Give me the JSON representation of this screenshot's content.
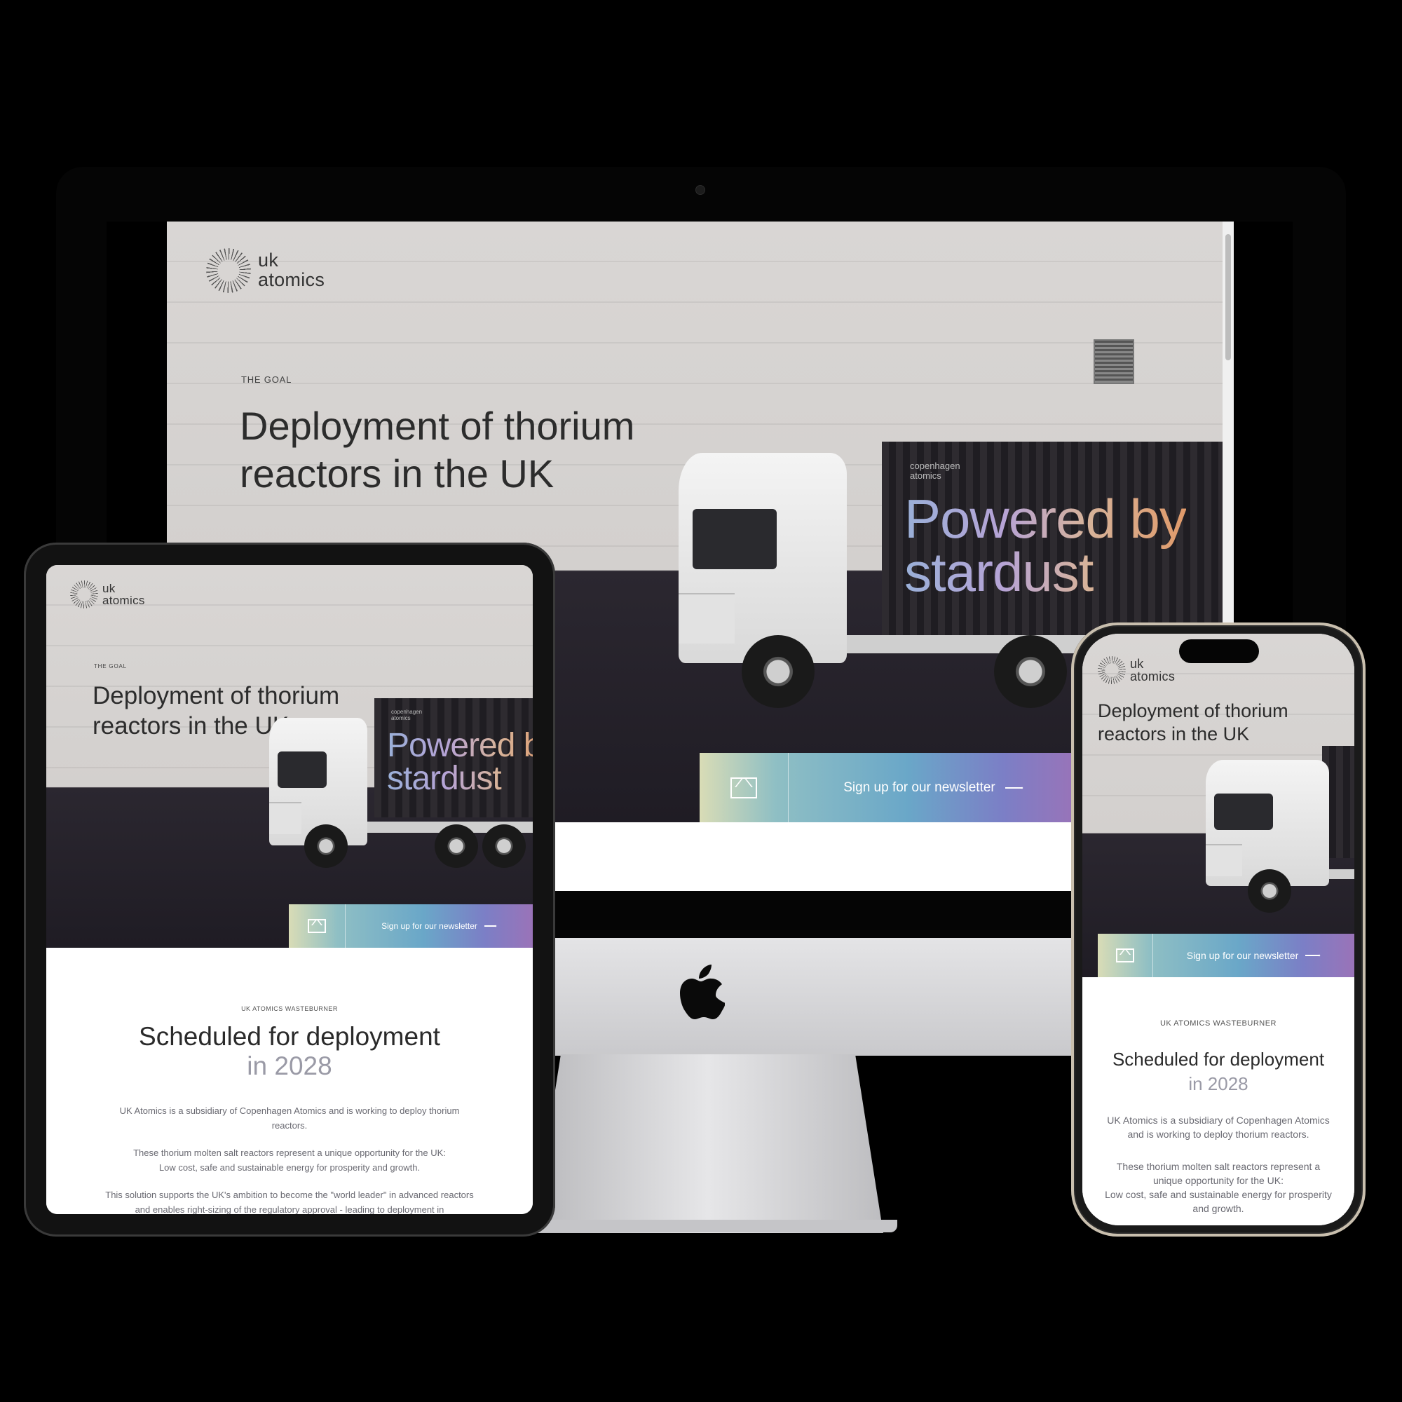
{
  "brand": {
    "line1": "uk",
    "line2": "atomics"
  },
  "hero": {
    "kicker": "THE GOAL",
    "headline_line1": "Deployment of thorium",
    "headline_line2": "reactors in the UK"
  },
  "truck": {
    "container_brand_line1": "copenhagen",
    "container_brand_line2": "atomics",
    "slogan_line1": "Powered by",
    "slogan_line2": "stardust"
  },
  "newsletter": {
    "label": "Sign up for our newsletter",
    "icon": "mail-icon"
  },
  "section": {
    "tag": "UK ATOMICS WASTEBURNER",
    "title": "Scheduled for deployment",
    "year": "in 2028",
    "p1": "UK Atomics is a subsidiary of Copenhagen Atomics and is working to deploy thorium reactors.",
    "p2a": "These thorium molten salt reactors represent a unique opportunity for the UK:",
    "p2b": "Low cost, safe and sustainable energy for prosperity and growth.",
    "p3": "This solution supports the UK's ambition to become the \"world leader\" in advanced reactors and enables right-sizing of the regulatory approval - leading to deployment in"
  },
  "devices": [
    "iMac",
    "iPad",
    "iPhone"
  ],
  "colors": {
    "gradient_start": "#d9dcb6",
    "gradient_mid": "#6aa7c8",
    "gradient_end": "#9a73b8",
    "text_dark": "#2c2c2c"
  }
}
